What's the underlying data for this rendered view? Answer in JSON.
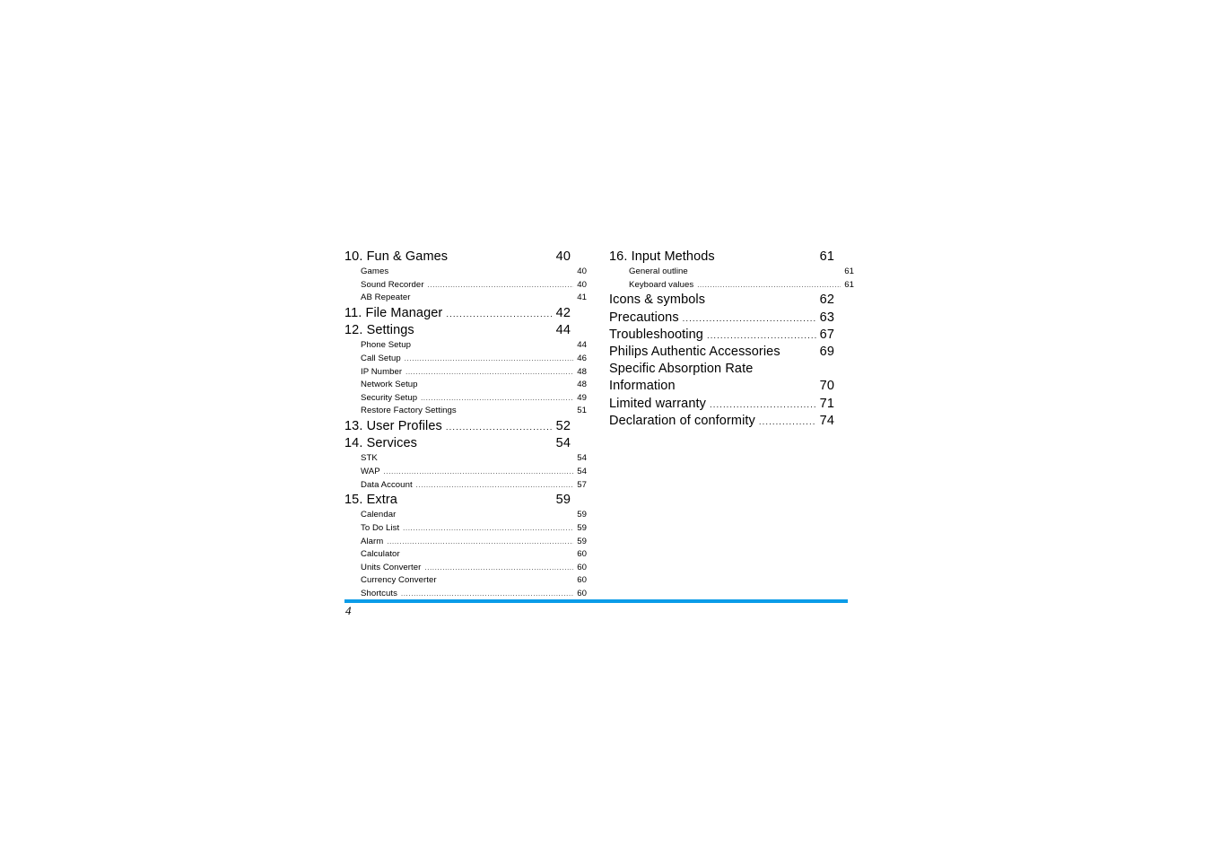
{
  "document": {
    "type": "table-of-contents",
    "folio": "4",
    "rule_color": "#0b9ce8"
  },
  "columns": {
    "left": [
      {
        "level": 1,
        "label": "10. Fun & Games",
        "page": "40"
      },
      {
        "level": 2,
        "label": "Games",
        "page": "40"
      },
      {
        "level": 2,
        "label": "Sound Recorder",
        "page": "40"
      },
      {
        "level": 2,
        "label": "AB Repeater",
        "page": "41"
      },
      {
        "level": 1,
        "label": "11. File Manager",
        "page": "42"
      },
      {
        "level": 1,
        "label": "12. Settings",
        "page": "44"
      },
      {
        "level": 2,
        "label": "Phone Setup",
        "page": "44"
      },
      {
        "level": 2,
        "label": "Call Setup",
        "page": "46"
      },
      {
        "level": 2,
        "label": "IP Number",
        "page": "48"
      },
      {
        "level": 2,
        "label": "Network Setup",
        "page": "48"
      },
      {
        "level": 2,
        "label": "Security Setup",
        "page": "49"
      },
      {
        "level": 2,
        "label": "Restore Factory Settings",
        "page": "51"
      },
      {
        "level": 1,
        "label": "13. User Profiles",
        "page": "52"
      },
      {
        "level": 1,
        "label": "14. Services",
        "page": "54"
      },
      {
        "level": 2,
        "label": "STK",
        "page": "54"
      },
      {
        "level": 2,
        "label": "WAP",
        "page": "54"
      },
      {
        "level": 2,
        "label": "Data Account",
        "page": "57"
      },
      {
        "level": 1,
        "label": "15. Extra",
        "page": "59"
      },
      {
        "level": 2,
        "label": "Calendar",
        "page": "59"
      },
      {
        "level": 2,
        "label": "To Do List",
        "page": "59"
      },
      {
        "level": 2,
        "label": "Alarm",
        "page": "59"
      },
      {
        "level": 2,
        "label": "Calculator",
        "page": "60"
      },
      {
        "level": 2,
        "label": "Units Converter",
        "page": "60"
      },
      {
        "level": 2,
        "label": "Currency Converter",
        "page": "60"
      },
      {
        "level": 2,
        "label": "Shortcuts",
        "page": "60"
      }
    ],
    "right": [
      {
        "level": 1,
        "label": "16. Input Methods",
        "page": "61"
      },
      {
        "level": 2,
        "label": "General outline",
        "page": "61"
      },
      {
        "level": 2,
        "label": "Keyboard values",
        "page": "61"
      },
      {
        "level": 1,
        "label": "Icons & symbols",
        "page": "62"
      },
      {
        "level": 1,
        "label": "Precautions",
        "page": "63"
      },
      {
        "level": 1,
        "label": "Troubleshooting",
        "page": "67"
      },
      {
        "level": 1,
        "label": "Philips Authentic Accessories",
        "page": "69"
      },
      {
        "level": 1,
        "label": "Specific Absorption Rate",
        "page": "",
        "nodots": true
      },
      {
        "level": 1,
        "label": "Information",
        "page": "70"
      },
      {
        "level": 1,
        "label": "Limited warranty",
        "page": "71"
      },
      {
        "level": 1,
        "label": "Declaration of conformity",
        "page": "74"
      }
    ]
  }
}
